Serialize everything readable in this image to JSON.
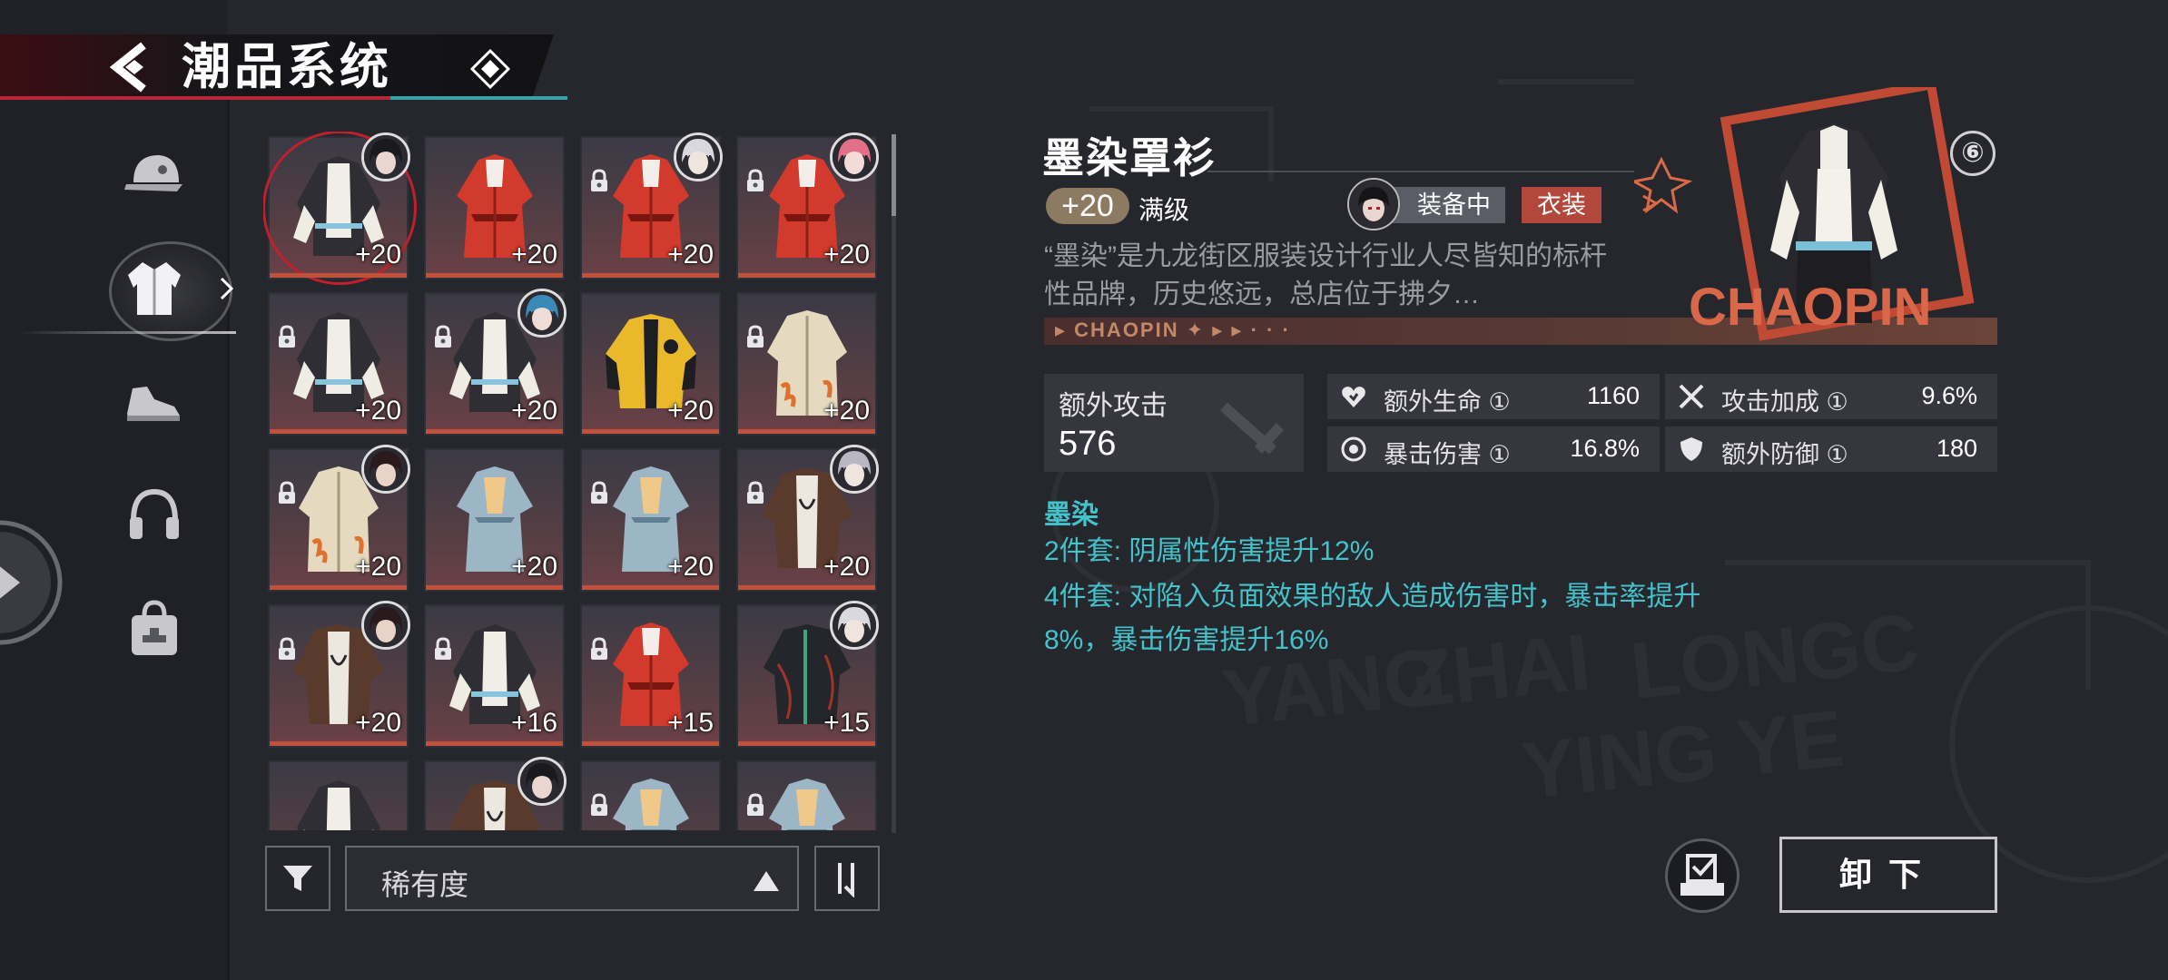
{
  "header": {
    "title": "潮品系统"
  },
  "categories": [
    {
      "icon": "cap-icon",
      "active": false
    },
    {
      "icon": "jacket-icon",
      "active": true
    },
    {
      "icon": "shoes-icon",
      "active": false
    },
    {
      "icon": "headphones-icon",
      "active": false
    },
    {
      "icon": "bag-icon",
      "active": false
    }
  ],
  "items": [
    {
      "level": "+20",
      "garment": "black-coat",
      "locked": false,
      "avatar": "dark",
      "selected": true
    },
    {
      "level": "+20",
      "garment": "red-dress",
      "locked": false,
      "avatar": null
    },
    {
      "level": "+20",
      "garment": "red-dress",
      "locked": true,
      "avatar": "white"
    },
    {
      "level": "+20",
      "garment": "red-dress",
      "locked": true,
      "avatar": "pink"
    },
    {
      "level": "+20",
      "garment": "black-coat",
      "locked": true,
      "avatar": null
    },
    {
      "level": "+20",
      "garment": "black-coat",
      "locked": true,
      "avatar": "blue"
    },
    {
      "level": "+20",
      "garment": "yellow-jacket",
      "locked": false,
      "avatar": null
    },
    {
      "level": "+20",
      "garment": "beige-coat",
      "locked": true,
      "avatar": null
    },
    {
      "level": "+20",
      "garment": "beige-coat",
      "locked": true,
      "avatar": "dark-red"
    },
    {
      "level": "+20",
      "garment": "blue-robe",
      "locked": false,
      "avatar": null
    },
    {
      "level": "+20",
      "garment": "blue-robe",
      "locked": true,
      "avatar": null
    },
    {
      "level": "+20",
      "garment": "brown-jacket",
      "locked": true,
      "avatar": "silver"
    },
    {
      "level": "+20",
      "garment": "brown-jacket",
      "locked": true,
      "avatar": "dark-red"
    },
    {
      "level": "+16",
      "garment": "black-coat",
      "locked": true,
      "avatar": null
    },
    {
      "level": "+15",
      "garment": "red-dress",
      "locked": true,
      "avatar": null
    },
    {
      "level": "+15",
      "garment": "black-shirt",
      "locked": false,
      "avatar": "white"
    },
    {
      "level": "",
      "garment": "black-coat",
      "locked": false,
      "avatar": null
    },
    {
      "level": "",
      "garment": "brown-jacket",
      "locked": false,
      "avatar": "dark"
    },
    {
      "level": "",
      "garment": "blue-robe",
      "locked": true,
      "avatar": null
    },
    {
      "level": "",
      "garment": "blue-robe",
      "locked": true,
      "avatar": null
    }
  ],
  "controls": {
    "sort_label": "稀有度"
  },
  "detail": {
    "name": "墨染罩衫",
    "level": "+20",
    "max_level_text": "满级",
    "equipped_text": "装备中",
    "type_text": "衣装",
    "description": "“墨染”是九龙街区服装设计行业人尽皆知的标杆性品牌，历史悠远，总店位于拂夕…",
    "deco_text": "▸ CHAOPIN ✦ ▸ ▸ · · ·",
    "poster_text": "CHAOPIN",
    "rank": "⑥",
    "main_stat": {
      "label": "额外攻击",
      "value": "576"
    },
    "stats": [
      {
        "label": "额外生命 ①",
        "value": "1160",
        "icon": "heart-icon"
      },
      {
        "label": "攻击加成 ①",
        "value": "9.6%",
        "icon": "crossed-swords-icon"
      },
      {
        "label": "暴击伤害 ①",
        "value": "16.8%",
        "icon": "crit-icon"
      },
      {
        "label": "额外防御 ①",
        "value": "180",
        "icon": "shield-icon"
      }
    ],
    "set_name": "墨染",
    "set_effects": [
      "2件套: 阴属性伤害提升12%",
      "4件套: 对陷入负面效果的敌人造成伤害时，暴击率提升8%，暴击伤害提升16%"
    ],
    "unequip_label": "卸下"
  },
  "colors": {
    "accent_red": "#b9263a",
    "set_text": "#44c2c9",
    "rarity_orange": "#c1513a",
    "type_badge": "#b2473c"
  }
}
